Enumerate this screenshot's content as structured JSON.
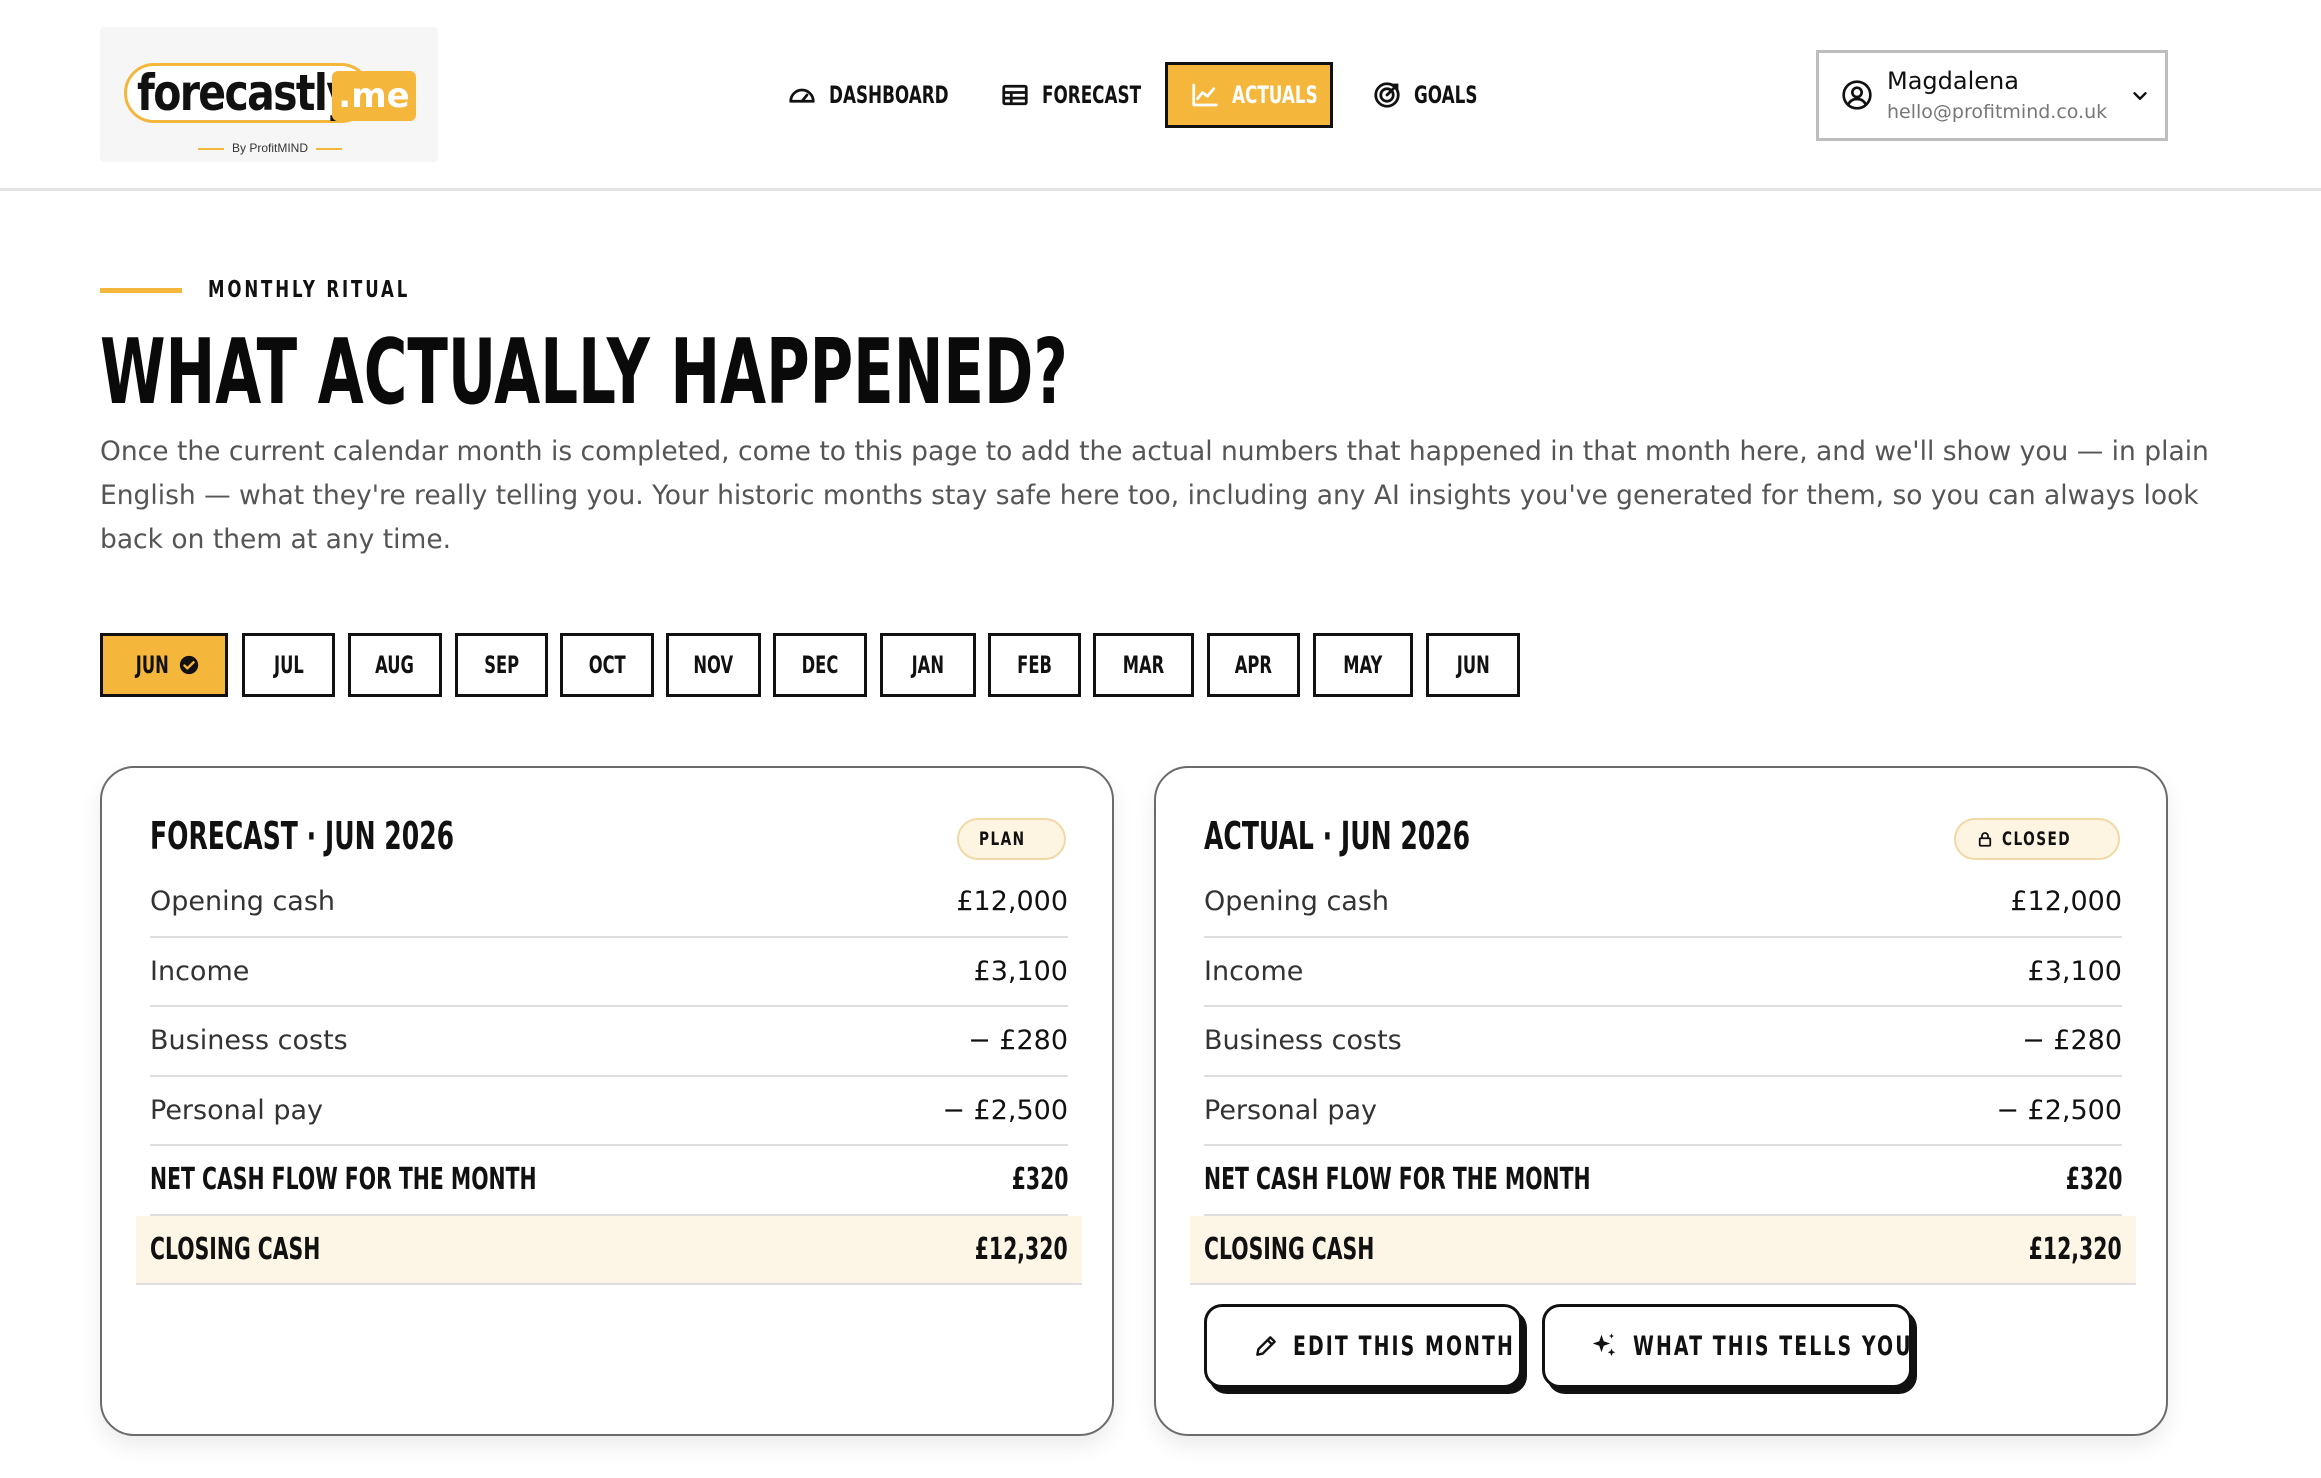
{
  "brand": {
    "name": "forecastly",
    "suffix": ".me",
    "tagline": "By ProfitMIND"
  },
  "nav": {
    "items": [
      {
        "label": "DASHBOARD",
        "icon": "gauge-icon",
        "active": false
      },
      {
        "label": "FORECAST",
        "icon": "table-icon",
        "active": false
      },
      {
        "label": "ACTUALS",
        "icon": "chart-line-icon",
        "active": true
      },
      {
        "label": "GOALS",
        "icon": "target-icon",
        "active": false
      }
    ]
  },
  "user": {
    "name": "Magdalena",
    "email": "hello@profitmind.co.uk",
    "icon": "user-circle-icon"
  },
  "intro": {
    "eyebrow": "MONTHLY RITUAL",
    "title": "WHAT ACTUALLY HAPPENED?",
    "description": "Once the current calendar month is completed, come to this page to add the actual numbers that happened in that month here, and we'll show you — in plain English — what they're really telling you. Your historic months stay safe here too, including any AI insights you've generated for them, so you can always look back on them at any time."
  },
  "months": [
    {
      "label": "JUN",
      "active": true,
      "completed": true
    },
    {
      "label": "JUL"
    },
    {
      "label": "AUG"
    },
    {
      "label": "SEP"
    },
    {
      "label": "OCT"
    },
    {
      "label": "NOV"
    },
    {
      "label": "DEC"
    },
    {
      "label": "JAN"
    },
    {
      "label": "FEB"
    },
    {
      "label": "MAR"
    },
    {
      "label": "APR"
    },
    {
      "label": "MAY"
    },
    {
      "label": "JUN"
    }
  ],
  "forecast_card": {
    "title": "FORECAST · JUN 2026",
    "badge": "PLAN",
    "rows": [
      {
        "label": "Opening cash",
        "value": "£12,000"
      },
      {
        "label": "Income",
        "value": "£3,100"
      },
      {
        "label": "Business costs",
        "value": "− £280"
      },
      {
        "label": "Personal pay",
        "value": "− £2,500"
      }
    ],
    "net": {
      "label": "NET CASH FLOW FOR THE MONTH",
      "value": "£320"
    },
    "closing": {
      "label": "CLOSING CASH",
      "value": "£12,320"
    }
  },
  "actual_card": {
    "title": "ACTUAL · JUN 2026",
    "badge": "CLOSED",
    "badge_icon": "lock-icon",
    "rows": [
      {
        "label": "Opening cash",
        "value": "£12,000"
      },
      {
        "label": "Income",
        "value": "£3,100"
      },
      {
        "label": "Business costs",
        "value": "− £280"
      },
      {
        "label": "Personal pay",
        "value": "− £2,500"
      }
    ],
    "net": {
      "label": "NET CASH FLOW FOR THE MONTH",
      "value": "£320"
    },
    "closing": {
      "label": "CLOSING CASH",
      "value": "£12,320"
    },
    "buttons": {
      "edit": {
        "label": "EDIT THIS MONTH",
        "icon": "pencil-icon"
      },
      "insights": {
        "label": "WHAT THIS TELLS YOU",
        "icon": "sparkle-icon"
      }
    }
  },
  "colors": {
    "accent": "#f5b63c",
    "highlight": "#fdf6e6",
    "text": "#111111",
    "muted": "#555555"
  }
}
